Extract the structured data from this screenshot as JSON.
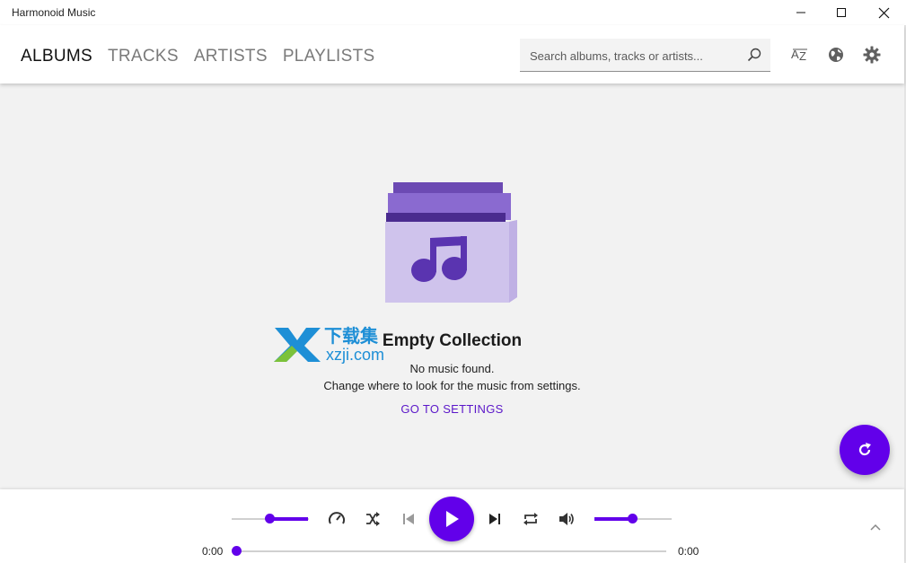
{
  "window": {
    "title": "Harmonoid Music",
    "controls": [
      "minimize",
      "maximize",
      "close"
    ]
  },
  "header": {
    "tabs": [
      {
        "label": "ALBUMS",
        "active": true
      },
      {
        "label": "TRACKS",
        "active": false
      },
      {
        "label": "ARTISTS",
        "active": false
      },
      {
        "label": "PLAYLISTS",
        "active": false
      }
    ],
    "search": {
      "placeholder": "Search albums, tracks or artists...",
      "value": ""
    },
    "icons": [
      "sort-az-icon",
      "globe-icon",
      "gear-icon"
    ]
  },
  "empty_state": {
    "title": "Empty Collection",
    "line1": "No music found.",
    "line2": "Change where to look for the music from settings.",
    "action": "GO TO SETTINGS"
  },
  "watermark": {
    "cn": "下载集",
    "site": "xzji.com"
  },
  "player": {
    "elapsed": "0:00",
    "duration": "0:00",
    "progress": 0,
    "speed_level": 0.5,
    "volume_level": 0.5
  },
  "colors": {
    "accent": "#6200ea",
    "background": "#f2f2f2",
    "link": "#5b17c9"
  }
}
